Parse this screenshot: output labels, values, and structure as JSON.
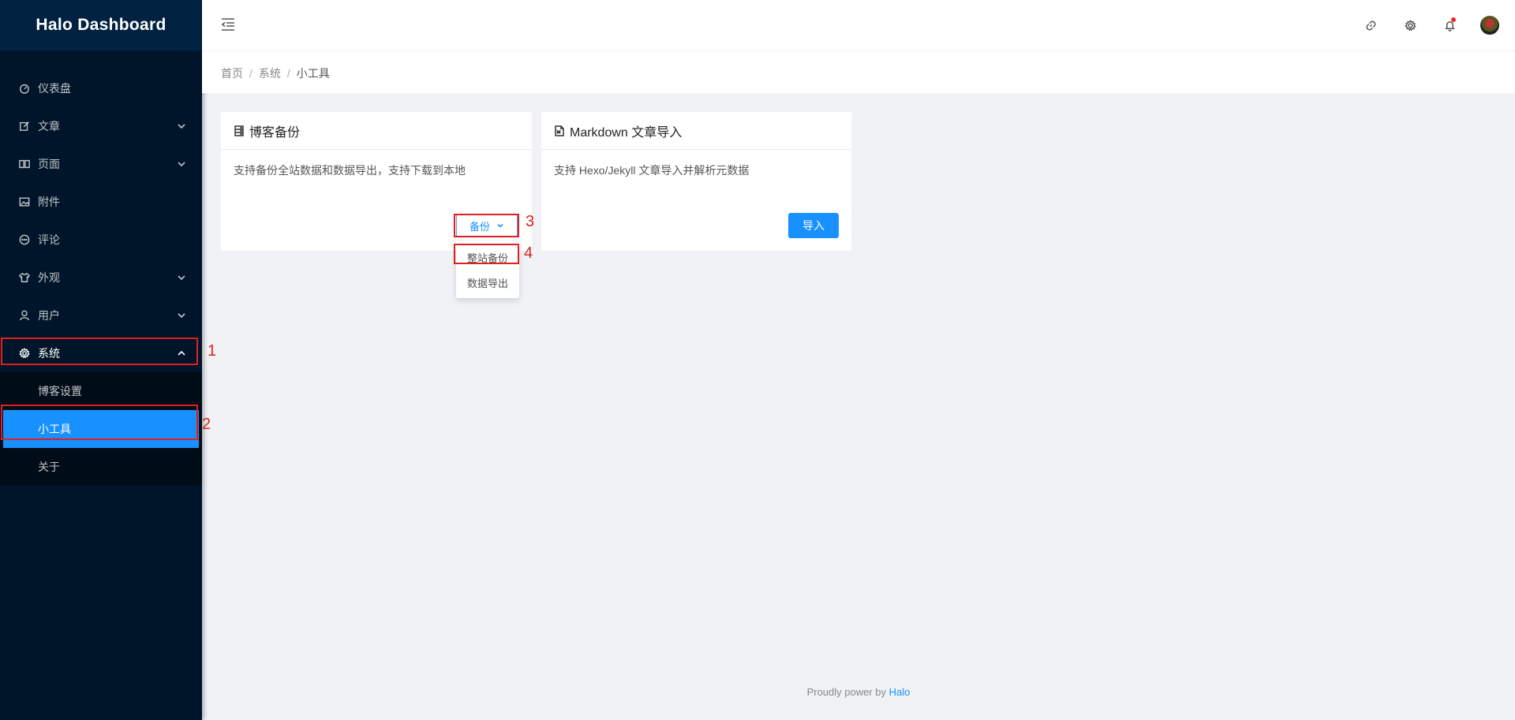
{
  "app": {
    "title": "Halo Dashboard"
  },
  "sidebar": {
    "items": [
      {
        "label": "仪表盘",
        "icon": "dashboard-icon",
        "has_arrow": false
      },
      {
        "label": "文章",
        "icon": "edit-icon",
        "has_arrow": true
      },
      {
        "label": "页面",
        "icon": "read-icon",
        "has_arrow": true
      },
      {
        "label": "附件",
        "icon": "picture-icon",
        "has_arrow": false
      },
      {
        "label": "评论",
        "icon": "message-icon",
        "has_arrow": false
      },
      {
        "label": "外观",
        "icon": "skin-icon",
        "has_arrow": true
      },
      {
        "label": "用户",
        "icon": "user-icon",
        "has_arrow": true
      },
      {
        "label": "系统",
        "icon": "setting-icon",
        "has_arrow": true,
        "open": true
      }
    ],
    "system_sub": [
      {
        "label": "博客设置",
        "active": false
      },
      {
        "label": "小工具",
        "active": true
      },
      {
        "label": "关于",
        "active": false
      }
    ]
  },
  "header": {
    "icons": [
      "link-icon",
      "setting-icon",
      "bell-icon"
    ],
    "notification_dot_color": "#f5222d"
  },
  "breadcrumb": {
    "home": "首页",
    "section": "系统",
    "current": "小工具"
  },
  "cards": {
    "backup": {
      "title": "博客备份",
      "icon": "hdd-icon",
      "description": "支持备份全站数据和数据导出，支持下载到本地",
      "button": "备份",
      "dropdown": [
        "整站备份",
        "数据导出"
      ]
    },
    "markdown": {
      "title": "Markdown 文章导入",
      "icon": "file-markdown-icon",
      "description": "支持 Hexo/Jekyll 文章导入并解析元数据",
      "button": "导入"
    }
  },
  "annotations": [
    "1",
    "2",
    "3",
    "4"
  ],
  "footer": {
    "prefix": "Proudly power by",
    "link": "Halo"
  },
  "colors": {
    "primary": "#1890ff",
    "sidebar": "#001529",
    "annotation": "#e02020"
  }
}
